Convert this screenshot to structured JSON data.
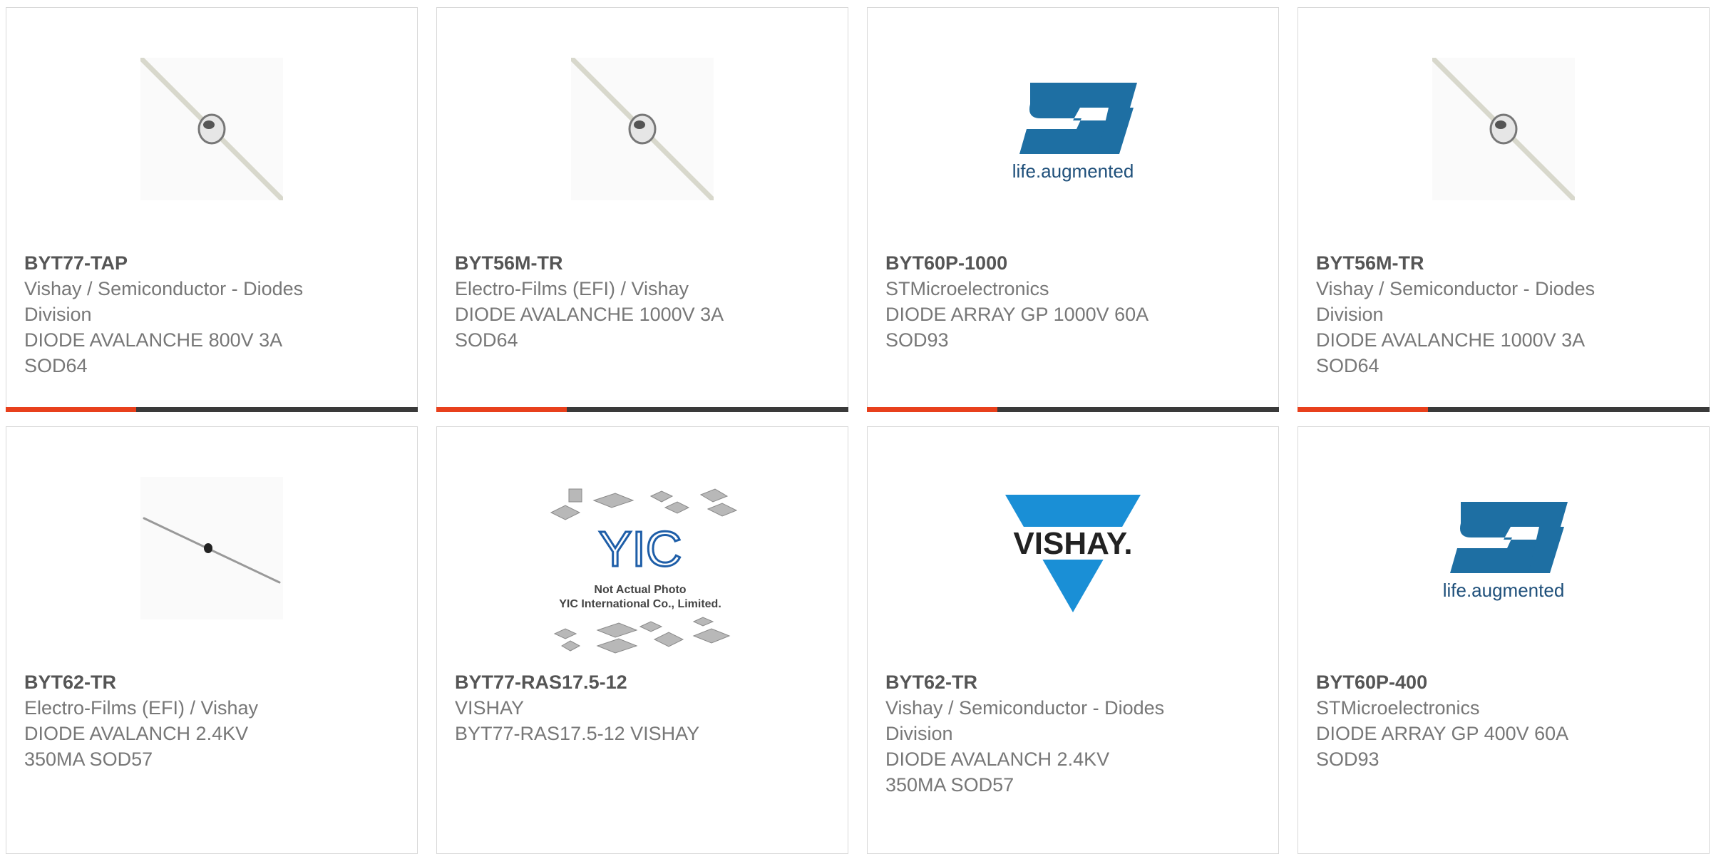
{
  "products": [
    {
      "part_number": "BYT77-TAP",
      "lines": [
        "Vishay / Semiconductor - Diodes",
        "Division",
        "DIODE AVALANCHE 800V 3A",
        "SOD64"
      ],
      "image": "axial-diode-photo"
    },
    {
      "part_number": "BYT56M-TR",
      "lines": [
        "Electro-Films (EFI) / Vishay",
        "DIODE AVALANCHE 1000V 3A",
        "SOD64"
      ],
      "image": "axial-diode-photo"
    },
    {
      "part_number": "BYT60P-1000",
      "lines": [
        "STMicroelectronics",
        "DIODE ARRAY GP 1000V 60A",
        "SOD93"
      ],
      "image": "st-logo",
      "logo_tagline": "life.augmented"
    },
    {
      "part_number": "BYT56M-TR",
      "lines": [
        "Vishay / Semiconductor - Diodes",
        "Division",
        "DIODE AVALANCHE 1000V 3A",
        "SOD64"
      ],
      "image": "axial-diode-photo"
    },
    {
      "part_number": "BYT62-TR",
      "lines": [
        "Electro-Films (EFI) / Vishay",
        "DIODE AVALANCH 2.4KV",
        "350MA SOD57"
      ],
      "image": "small-axial-diode-photo"
    },
    {
      "part_number": "BYT77-RAS17.5-12",
      "lines": [
        "VISHAY",
        "BYT77-RAS17.5-12 VISHAY"
      ],
      "image": "yic-placeholder",
      "placeholder_text_1": "Not Actual Photo",
      "placeholder_text_2": "YIC International Co., Limited.",
      "placeholder_logo": "YIC"
    },
    {
      "part_number": "BYT62-TR",
      "lines": [
        "Vishay / Semiconductor - Diodes",
        "Division",
        "DIODE AVALANCH 2.4KV",
        "350MA SOD57"
      ],
      "image": "vishay-logo",
      "logo_text": "VISHAY."
    },
    {
      "part_number": "BYT60P-400",
      "lines": [
        "STMicroelectronics",
        "DIODE ARRAY GP 400V 60A",
        "SOD93"
      ],
      "image": "st-logo",
      "logo_tagline": "life.augmented"
    }
  ],
  "colors": {
    "accent": "#e8401c",
    "bar": "#3a3a3a",
    "st_blue": "#1e6fa3",
    "vishay_blue": "#1a8fd6"
  }
}
